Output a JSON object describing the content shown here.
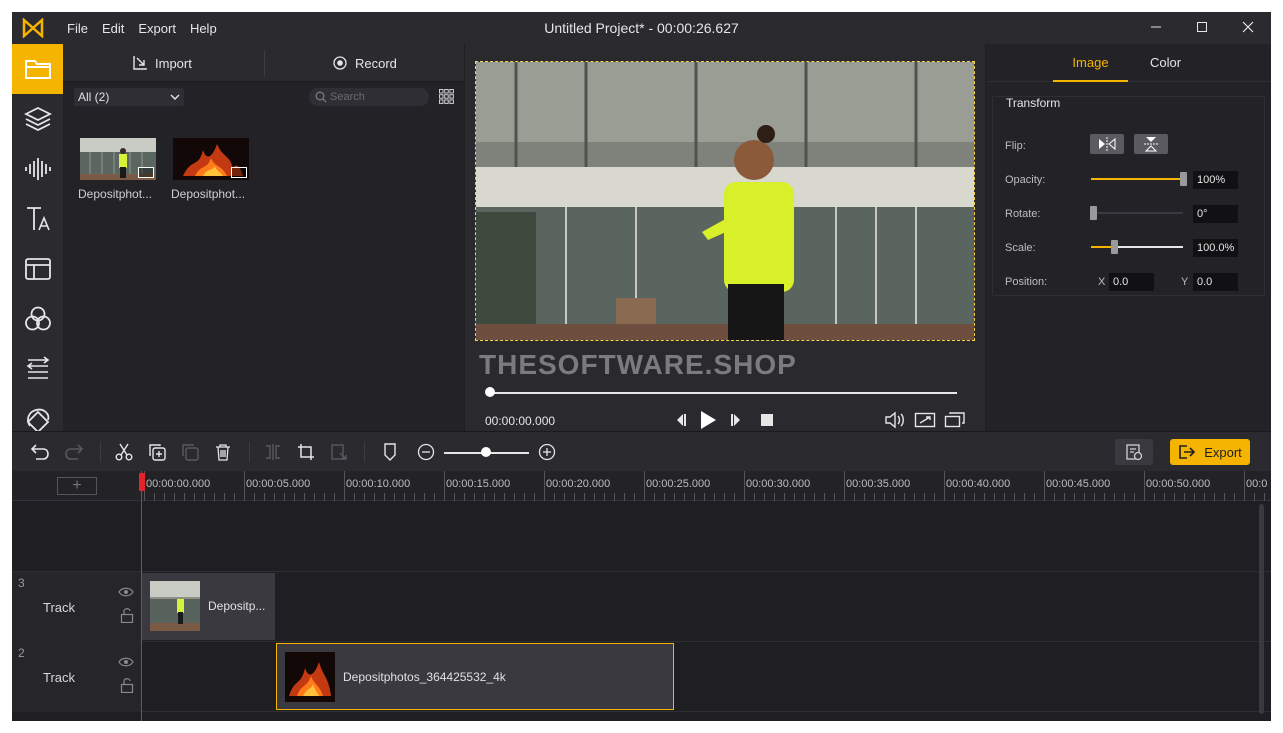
{
  "window": {
    "title": "Untitled Project* - 00:00:26.627",
    "menu": [
      "File",
      "Edit",
      "Export",
      "Help"
    ]
  },
  "sidebar": {
    "icons": [
      "folder-icon",
      "layers-icon",
      "audio-wave-icon",
      "text-icon",
      "template-icon",
      "filters-icon",
      "transitions-icon",
      "sticker-icon"
    ],
    "accent": "#f4b400"
  },
  "media": {
    "import_label": "Import",
    "record_label": "Record",
    "filter_value": "All (2)",
    "search_placeholder": "Search",
    "items": [
      {
        "label": "Depositphot..."
      },
      {
        "label": "Depositphot..."
      }
    ]
  },
  "preview": {
    "watermark": "THESOFTWARE.SHOP",
    "timecode": "00:00:00.000"
  },
  "props": {
    "tabs": [
      "Image",
      "Color"
    ],
    "section": "Transform",
    "flip_label": "Flip:",
    "opacity_label": "Opacity:",
    "opacity_value": "100%",
    "rotate_label": "Rotate:",
    "rotate_value": "0°",
    "scale_label": "Scale:",
    "scale_value": "100.0%",
    "position_label": "Position:",
    "x_label": "X",
    "x_value": "0.0",
    "y_label": "Y",
    "y_value": "0.0"
  },
  "toolbar": {
    "export_label": "Export"
  },
  "timeline": {
    "ticks": [
      "00:00:00.000",
      "00:00:05.000",
      "00:00:10.000",
      "00:00:15.000",
      "00:00:20.000",
      "00:00:25.000",
      "00:00:30.000",
      "00:00:35.000",
      "00:00:40.000",
      "00:00:45.000",
      "00:00:50.000",
      "00:0"
    ],
    "tracks": [
      {
        "number": "3",
        "name": "Track",
        "clip_label": "Depositp..."
      },
      {
        "number": "2",
        "name": "Track",
        "clip_label": "Depositphotos_364425532_4k"
      }
    ]
  }
}
